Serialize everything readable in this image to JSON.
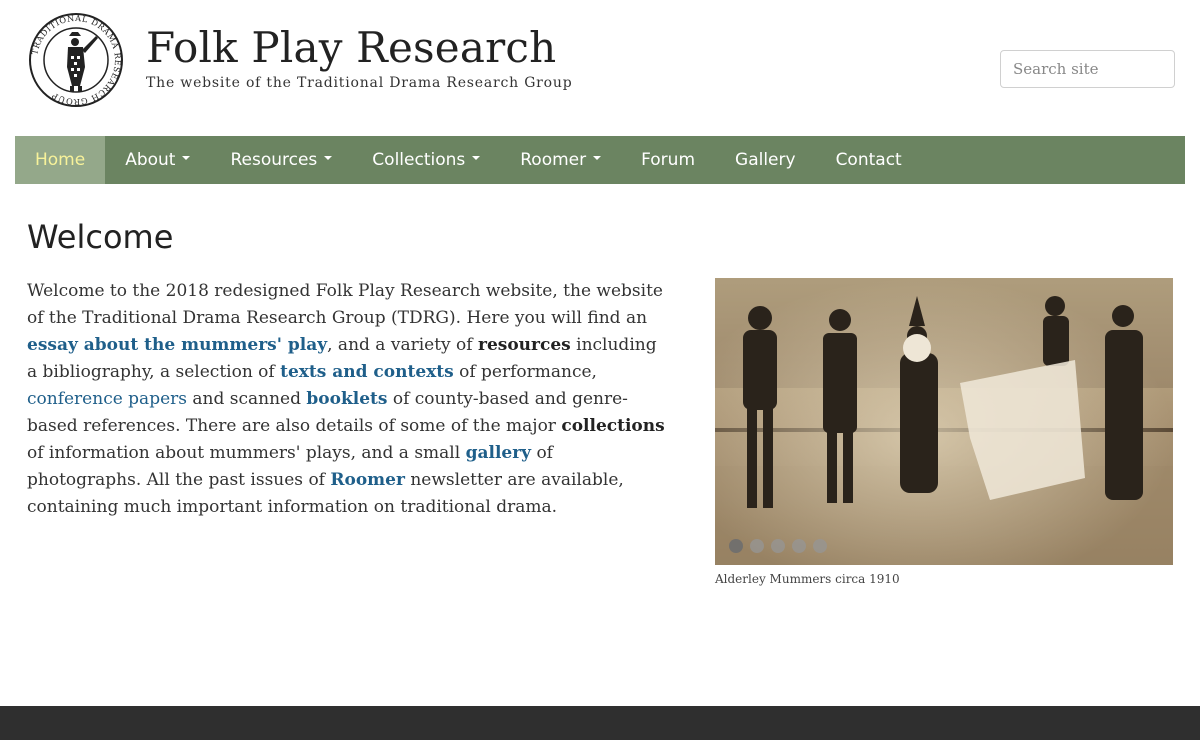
{
  "header": {
    "title": "Folk Play Research",
    "tagline": "The website of the Traditional Drama Research Group",
    "logo_ring_text": "TRADITIONAL DRAMA RESEARCH GROUP",
    "search_placeholder": "Search site"
  },
  "nav": {
    "items": [
      {
        "label": "Home",
        "active": true,
        "dropdown": false
      },
      {
        "label": "About",
        "dropdown": true
      },
      {
        "label": "Resources",
        "dropdown": true
      },
      {
        "label": "Collections",
        "dropdown": true
      },
      {
        "label": "Roomer",
        "dropdown": true
      },
      {
        "label": "Forum",
        "dropdown": false
      },
      {
        "label": "Gallery",
        "dropdown": false
      },
      {
        "label": "Contact",
        "dropdown": false
      }
    ]
  },
  "main": {
    "heading": "Welcome",
    "intro": {
      "t1": "Welcome to the 2018 redesigned Folk Play Research website, the website of the Traditional Drama Research Group (TDRG). Here you will find an ",
      "essay_link": "essay about the mummers' play",
      "t2": ", and a variety of ",
      "resources": "resources",
      "t3": " including a bibliography, a selection of ",
      "texts_link": "texts and contexts",
      "t4": " of performance, ",
      "conference_link": "conference papers",
      "t5": " and scanned ",
      "booklets_link": "booklets",
      "t6": " of county-based and genre-based references. There are also details of some of the major ",
      "collections": "collections",
      "t7": " of information about mummers' plays, and a small ",
      "gallery_link": "gallery",
      "t8": " of photographs. All the past issues of ",
      "roomer_link": "Roomer",
      "t9": " newsletter are available, containing much important information on traditional drama."
    }
  },
  "carousel": {
    "caption": "Alderley Mummers circa 1910",
    "slide_count": 5,
    "active_index": 0
  },
  "colors": {
    "nav_bg": "#6b8461",
    "nav_active_bg": "#94a88a",
    "nav_active_text": "#f7f29a",
    "link": "#1f5f8a",
    "footer": "#2f2f2f"
  }
}
